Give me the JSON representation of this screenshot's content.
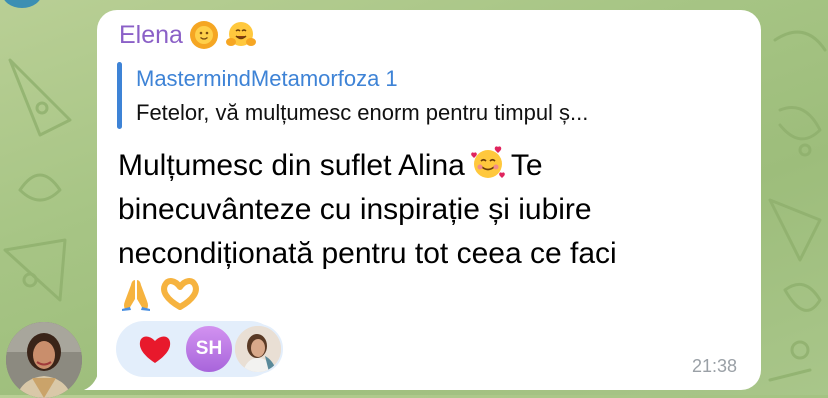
{
  "message": {
    "sender_name": "Elena",
    "sender_emojis": [
      "sun-with-face",
      "hugging-face"
    ],
    "reply": {
      "title": "MastermindMetamorfoza 1",
      "text": "Fetelor, vă mulțumesc enorm pentru timpul ș..."
    },
    "body_lines": [
      "Mulțumesc din suflet Alina",
      "Te",
      "binecuvânteze cu inspirație și iubire",
      "necondiționată pentru tot ceea ce faci"
    ],
    "inline_emoji": "smiling-face-with-hearts",
    "trailing_emojis": [
      "folded-hands",
      "heart-hands"
    ],
    "reactions": {
      "emoji": "red-heart",
      "reactor_initials": "SH"
    },
    "time": "21:38"
  },
  "colors": {
    "sender_name": "#8b60c7",
    "reply_accent": "#3e83d6",
    "bubble": "#ffffff",
    "reaction_pill": "#e3eefb",
    "background": "#a7c585",
    "time": "#9aa0a6"
  }
}
